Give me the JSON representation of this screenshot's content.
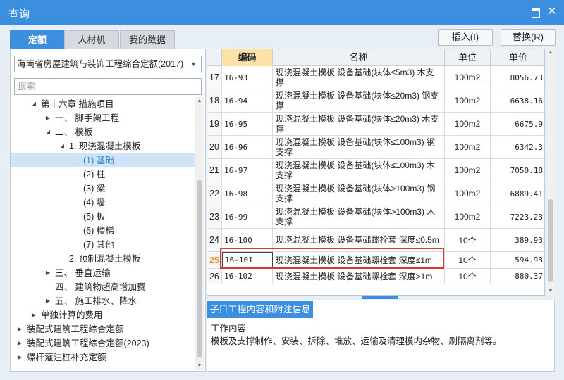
{
  "window": {
    "title": "查询"
  },
  "tabs": [
    "定额",
    "人材机",
    "我的数据"
  ],
  "buttons": {
    "insert": "插入(I)",
    "replace": "替换(R)"
  },
  "library_select": "海南省房屋建筑与装饰工程综合定额(2017)",
  "search_placeholder": "搜索",
  "tree": [
    {
      "label": "第十六章 措施项目",
      "level": 1,
      "caret": "down"
    },
    {
      "label": "一、 脚手架工程",
      "level": 2,
      "caret": "right"
    },
    {
      "label": "二、 模板",
      "level": 2,
      "caret": "down"
    },
    {
      "label": "1. 现浇混凝土模板",
      "level": 3,
      "caret": "down"
    },
    {
      "label": "(1) 基础",
      "level": 4,
      "caret": "",
      "selected": true
    },
    {
      "label": "(2) 柱",
      "level": 4,
      "caret": ""
    },
    {
      "label": "(3) 梁",
      "level": 4,
      "caret": ""
    },
    {
      "label": "(4) 墙",
      "level": 4,
      "caret": ""
    },
    {
      "label": "(5) 板",
      "level": 4,
      "caret": ""
    },
    {
      "label": "(6) 楼梯",
      "level": 4,
      "caret": ""
    },
    {
      "label": "(7) 其他",
      "level": 4,
      "caret": ""
    },
    {
      "label": "2. 预制混凝土模板",
      "level": 3,
      "caret": ""
    },
    {
      "label": "三、 垂直运输",
      "level": 2,
      "caret": "right"
    },
    {
      "label": "四、 建筑物超高增加费",
      "level": 2,
      "caret": ""
    },
    {
      "label": "五、 施工排水、降水",
      "level": 2,
      "caret": "right"
    },
    {
      "label": "单独计算的费用",
      "level": 1,
      "caret": "right"
    },
    {
      "label": "装配式建筑工程综合定额",
      "level": 0,
      "caret": "right"
    },
    {
      "label": "装配式建筑工程综合定额(2023)",
      "level": 0,
      "caret": "right"
    },
    {
      "label": "螺杆灌注桩补充定额",
      "level": 0,
      "caret": "right"
    }
  ],
  "grid": {
    "headers": {
      "num": "",
      "code": "编码",
      "name": "名称",
      "unit": "单位",
      "price": "单价"
    },
    "rows": [
      {
        "num": "17",
        "code": "16-93",
        "name": "现浇混凝土模板 设备基础(块体≤5m3) 木支撑",
        "unit": "100m2",
        "price": "8056.73"
      },
      {
        "num": "18",
        "code": "16-94",
        "name": "现浇混凝土模板 设备基础(块体≤20m3) 钢支撑",
        "unit": "100m2",
        "price": "6638.16"
      },
      {
        "num": "19",
        "code": "16-95",
        "name": "现浇混凝土模板 设备基础(块体≤20m3) 木支撑",
        "unit": "100m2",
        "price": "6675.9"
      },
      {
        "num": "20",
        "code": "16-96",
        "name": "现浇混凝土模板 设备基础(块体≤100m3) 钢支撑",
        "unit": "100m2",
        "price": "6342.3"
      },
      {
        "num": "21",
        "code": "16-97",
        "name": "现浇混凝土模板 设备基础(块体≤100m3) 木支撑",
        "unit": "100m2",
        "price": "7050.18"
      },
      {
        "num": "22",
        "code": "16-98",
        "name": "现浇混凝土模板 设备基础(块体>100m3) 钢支撑",
        "unit": "100m2",
        "price": "6889.41"
      },
      {
        "num": "23",
        "code": "16-99",
        "name": "现浇混凝土模板 设备基础(块体>100m3) 木支撑",
        "unit": "100m2",
        "price": "7223.23"
      },
      {
        "num": "24",
        "code": "16-100",
        "name": "现浇混凝土模板 设备基础螺栓套 深度≤0.5m",
        "unit": "10个",
        "price": "389.93"
      },
      {
        "num": "25",
        "code": "16-101",
        "name": "现浇混凝土模板 设备基础螺栓套 深度≤1m",
        "unit": "10个",
        "price": "594.93",
        "active": true
      },
      {
        "num": "26",
        "code": "16-102",
        "name": "现浇混凝土模板 设备基础螺栓套 深度>1m",
        "unit": "10个",
        "price": "880.37"
      }
    ]
  },
  "info": {
    "tab": "子目工程内容和附注信息",
    "line1": "工作内容:",
    "line2": "模板及支撑制作、安装、拆除、堆放、运输及清理模内杂物、刷隔离剂等。"
  },
  "colors": {
    "accent": "#3c8ede",
    "highlight": "#e03333",
    "header_code": "#fde2a8"
  }
}
